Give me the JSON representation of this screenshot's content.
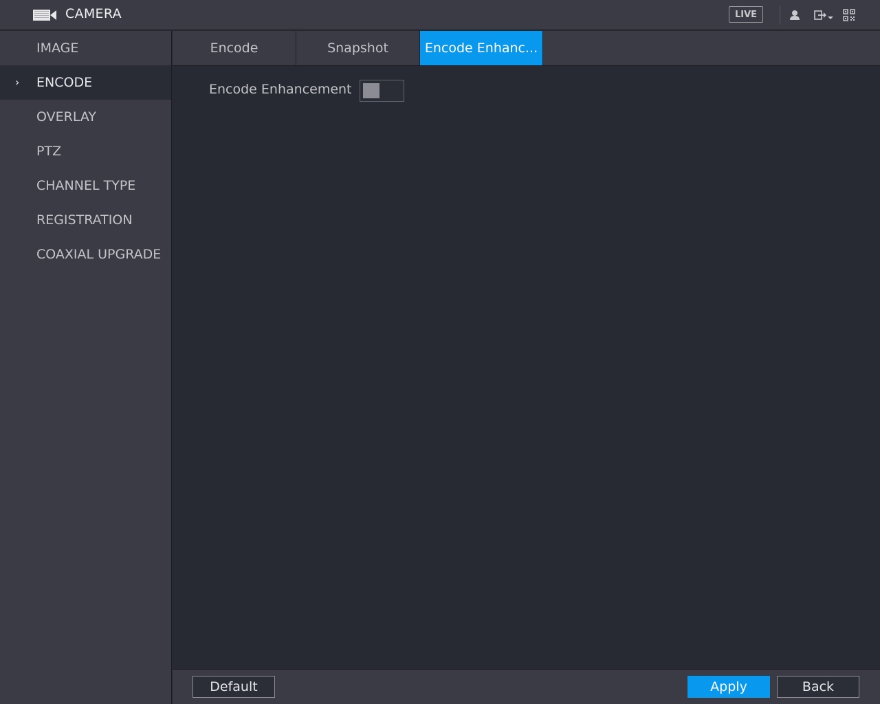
{
  "header": {
    "title": "CAMERA",
    "title_icon": "camera-icon",
    "live_label": "LIVE",
    "icons": [
      "user-icon",
      "logout-icon",
      "chevron-down-icon",
      "qr-code-icon"
    ]
  },
  "sidebar": {
    "items": [
      {
        "label": "IMAGE",
        "active": false
      },
      {
        "label": "ENCODE",
        "active": true
      },
      {
        "label": "OVERLAY",
        "active": false
      },
      {
        "label": "PTZ",
        "active": false
      },
      {
        "label": "CHANNEL TYPE",
        "active": false
      },
      {
        "label": "REGISTRATION",
        "active": false
      },
      {
        "label": "COAXIAL UPGRADE",
        "active": false
      }
    ]
  },
  "tabs": [
    {
      "label": "Encode",
      "active": false
    },
    {
      "label": "Snapshot",
      "active": false
    },
    {
      "label": "Encode Enhanc...",
      "active": true
    }
  ],
  "content": {
    "encode_enhancement_label": "Encode Enhancement",
    "encode_enhancement_enabled": false
  },
  "footer": {
    "default_label": "Default",
    "apply_label": "Apply",
    "back_label": "Back"
  },
  "colors": {
    "accent": "#0898ee",
    "panel": "#3a3b44",
    "background": "#282a33"
  }
}
